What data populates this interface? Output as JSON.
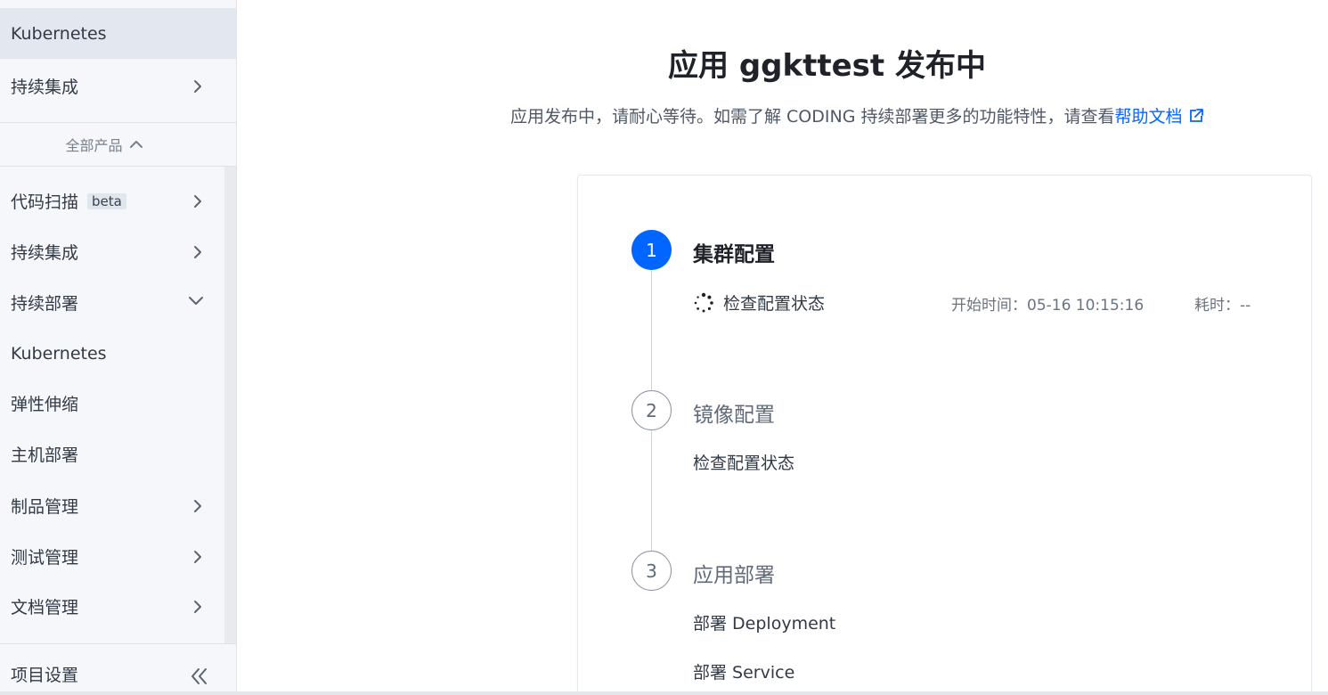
{
  "sidebar": {
    "top_items": [
      {
        "label": "Kubernetes",
        "active": true
      },
      {
        "label": "持续集成"
      }
    ],
    "all_products_label": "全部产品",
    "items": [
      {
        "label": "代码扫描",
        "badge": "beta"
      },
      {
        "label": "持续集成"
      },
      {
        "label": "持续部署"
      },
      {
        "label": "Kubernetes"
      },
      {
        "label": "弹性伸缩"
      },
      {
        "label": "主机部署"
      },
      {
        "label": "制品管理"
      },
      {
        "label": "测试管理"
      },
      {
        "label": "文档管理"
      }
    ],
    "project_settings_label": "项目设置"
  },
  "main": {
    "title": "应用 ggkttest 发布中",
    "subtitle": "应用发布中，请耐心等待。如需了解 CODING 持续部署更多的功能特性，请查看",
    "help_link": "帮助文档",
    "steps": [
      {
        "number": "1",
        "title": "集群配置",
        "state": "active",
        "tasks": [
          {
            "label": "检查配置状态",
            "status": "running",
            "start_time": "开始时间：05-16 10:15:16",
            "duration": "耗时：--"
          }
        ]
      },
      {
        "number": "2",
        "title": "镜像配置",
        "state": "pending",
        "tasks": [
          {
            "label": "检查配置状态"
          }
        ]
      },
      {
        "number": "3",
        "title": "应用部署",
        "state": "pending",
        "tasks": [
          {
            "label": "部署 Deployment"
          },
          {
            "label": "部署 Service"
          }
        ]
      }
    ]
  },
  "colors": {
    "accent": "#0066ff",
    "sidebar_bg": "#f5f7fa",
    "sidebar_active_bg": "#e3e7ef"
  },
  "icons": [
    "chevron-right-icon",
    "chevron-down-icon",
    "chevron-up-icon",
    "external-link-icon",
    "spinner-icon",
    "double-chevron-left-icon"
  ]
}
